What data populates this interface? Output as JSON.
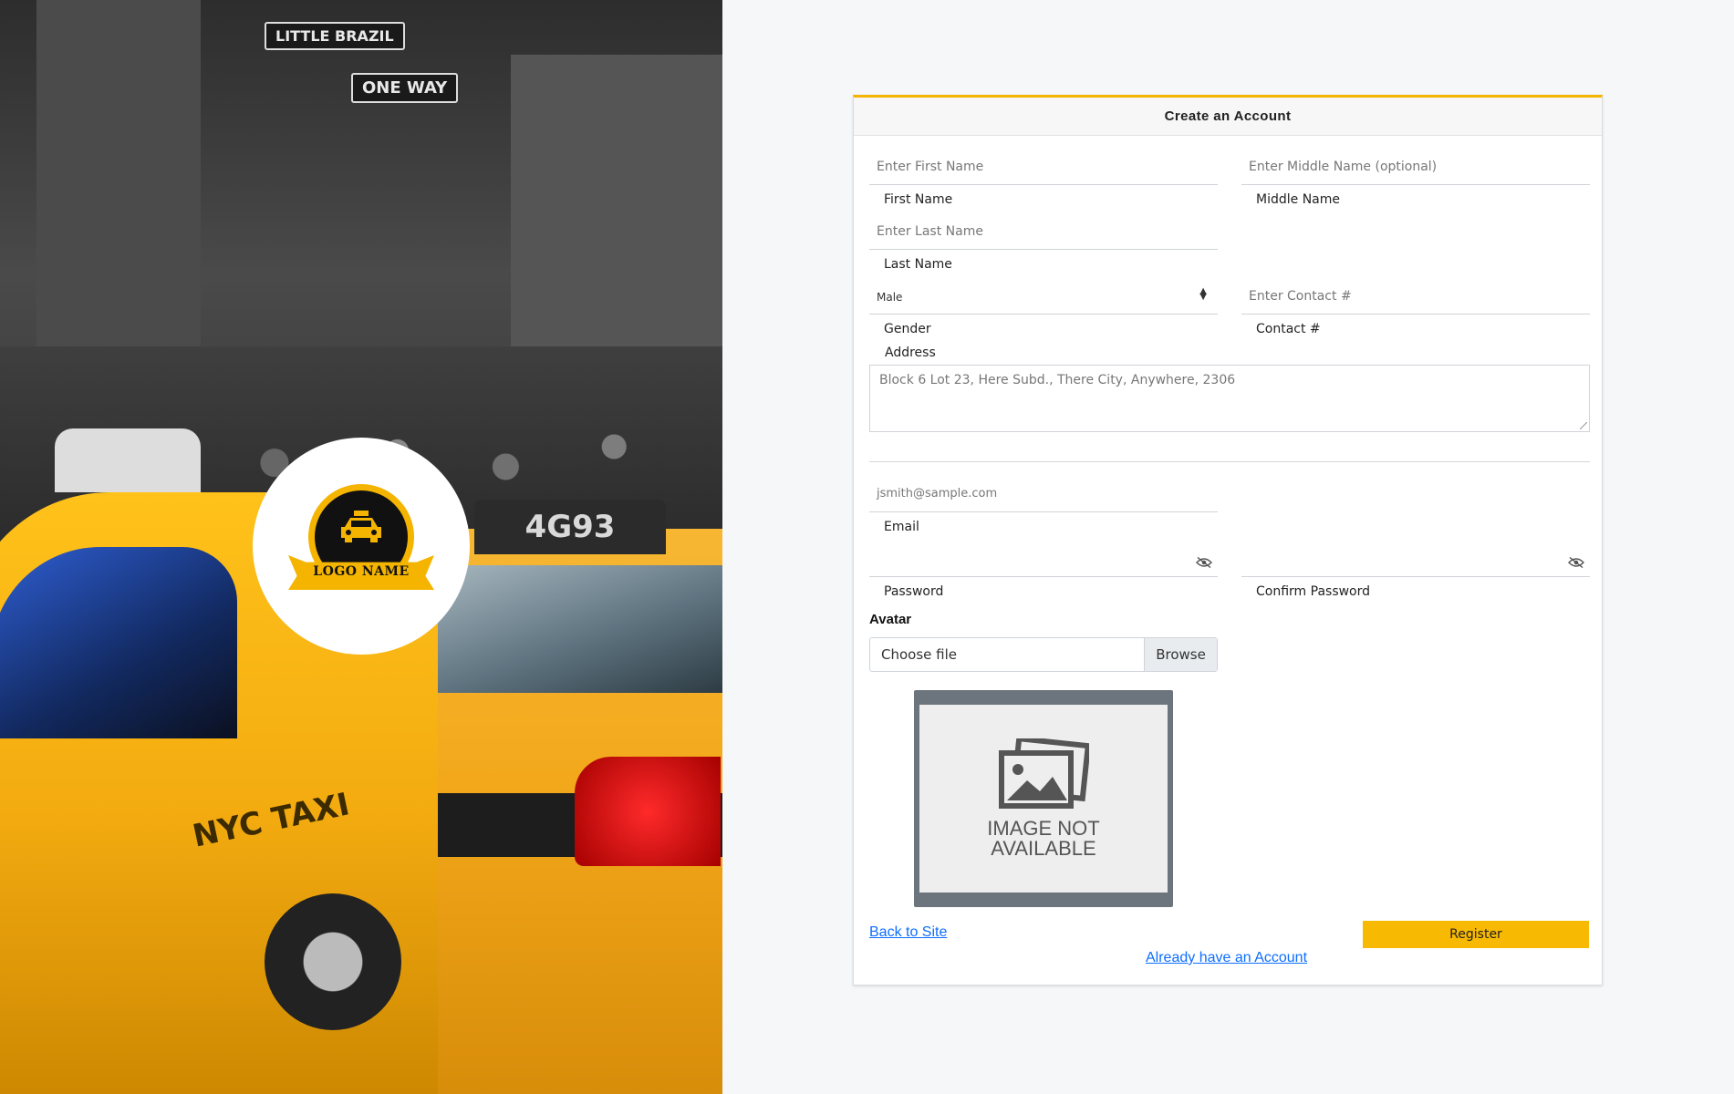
{
  "brand": {
    "logo_text": "LOGO NAME"
  },
  "background": {
    "sign1": "LITTLE BRAZIL",
    "sign2": "ONE WAY",
    "roof_sign": "4G93",
    "taxi_text": "NYC TAXI"
  },
  "form": {
    "title": "Create an Account",
    "first_name": {
      "placeholder": "Enter First Name",
      "label": "First Name"
    },
    "middle_name": {
      "placeholder": "Enter Middle Name (optional)",
      "label": "Middle Name"
    },
    "last_name": {
      "placeholder": "Enter Last Name",
      "label": "Last Name"
    },
    "gender": {
      "value": "Male",
      "label": "Gender"
    },
    "contact": {
      "placeholder": "Enter Contact #",
      "label": "Contact #"
    },
    "address": {
      "label": "Address",
      "placeholder": "Block 6 Lot 23, Here Subd., There City, Anywhere, 2306"
    },
    "email": {
      "placeholder": "jsmith@sample.com",
      "label": "Email"
    },
    "password": {
      "label": "Password"
    },
    "confirm_password": {
      "label": "Confirm Password"
    },
    "avatar": {
      "label": "Avatar",
      "file_placeholder": "Choose file",
      "browse_label": "Browse",
      "image_text_line1": "IMAGE NOT",
      "image_text_line2": "AVAILABLE"
    },
    "back_link": "Back to Site",
    "register_label": "Register",
    "login_link": "Already have an Account"
  },
  "colors": {
    "accent": "#f4b400",
    "link": "#0d6efd"
  }
}
